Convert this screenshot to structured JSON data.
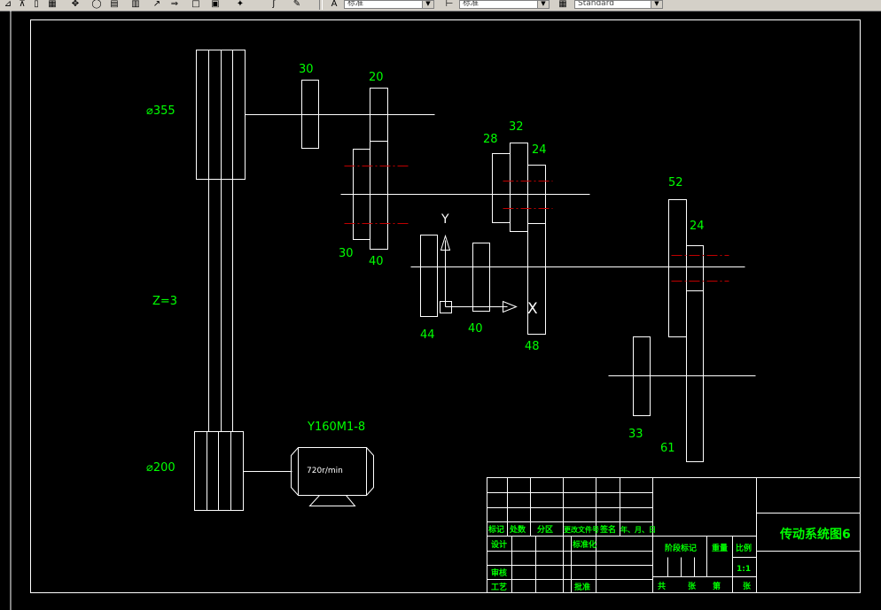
{
  "toolbar": {
    "icons": [
      "align-icon",
      "layout-icon",
      "pan-icon",
      "orbit-icon",
      "table-icon",
      "chart-icon",
      "arrow-icon",
      "arrow-right-icon",
      "box-icon",
      "hatch-icon",
      "star-icon",
      "curve-icon",
      "paint-icon"
    ],
    "text_style_value": "标准",
    "dim_style_value": "标准",
    "table_style_value": "Standard"
  },
  "drawing": {
    "labels": {
      "pulley_large": "⌀355",
      "pulley_small": "⌀200",
      "belt_count": "Z=3",
      "motor_model": "Y160M1-8",
      "motor_speed": "720r/min",
      "ucs_y": "Y",
      "ucs_x": "X"
    },
    "gears": [
      "30",
      "20",
      "30",
      "40",
      "28",
      "32",
      "24",
      "44",
      "40",
      "48",
      "52",
      "24",
      "33",
      "61"
    ]
  },
  "title_block": {
    "title": "传动系统图6",
    "grid_headers": [
      "标记",
      "处数",
      "分区",
      "更改文件号",
      "签名",
      "年、月、日"
    ],
    "roles": {
      "design": "设计",
      "review": "审核",
      "process": "工艺",
      "standardize": "标准化",
      "approve": "批准"
    },
    "stage_mark": "阶段标记",
    "weight": "重量",
    "scale_label": "比例",
    "scale_value": "1:1",
    "sheet": [
      "共",
      "张",
      "第",
      "张"
    ]
  }
}
